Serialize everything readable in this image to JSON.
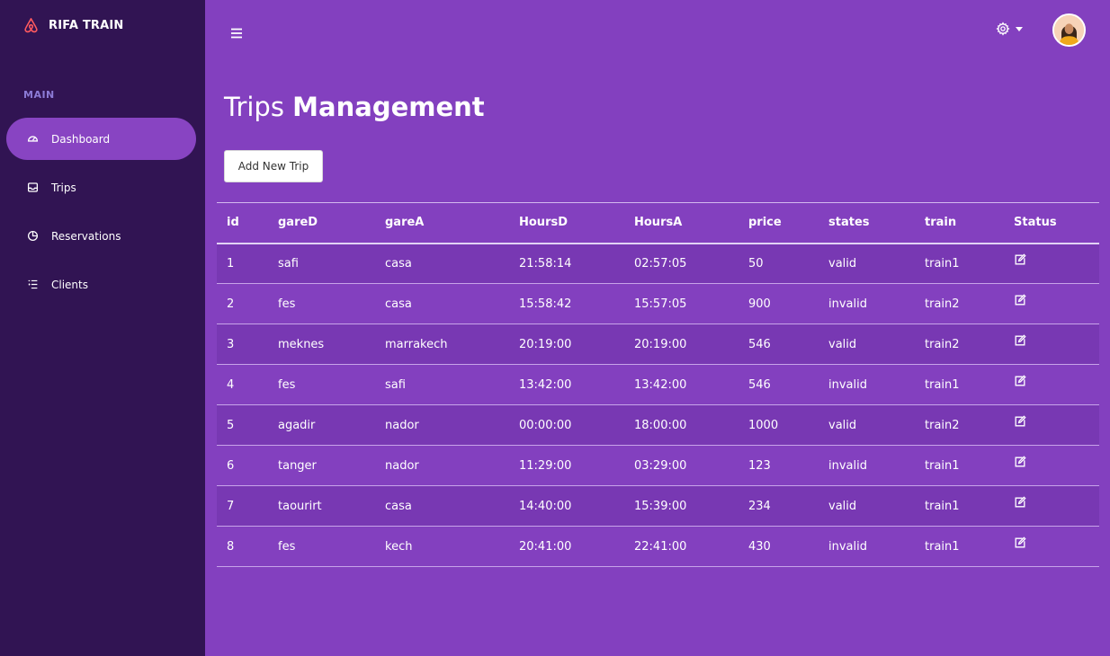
{
  "brand": {
    "name": "RIFA TRAIN",
    "icon": "airbnb-logo-icon"
  },
  "sidebar": {
    "section_title": "MAIN",
    "items": [
      {
        "label": "Dashboard",
        "icon": "dashboard-gauge-icon",
        "active": true
      },
      {
        "label": "Trips",
        "icon": "inbox-icon"
      },
      {
        "label": "Reservations",
        "icon": "pie-chart-icon"
      },
      {
        "label": "Clients",
        "icon": "list-icon"
      }
    ]
  },
  "header": {
    "menu_icon": "hamburger-icon",
    "settings_icon": "gear-icon"
  },
  "page": {
    "title_light": "Trips",
    "title_bold": "Management",
    "add_button": "Add New Trip"
  },
  "table": {
    "columns": [
      "id",
      "gareD",
      "gareA",
      "HoursD",
      "HoursA",
      "price",
      "states",
      "train",
      "Status"
    ],
    "rows": [
      [
        "1",
        "safi",
        "casa",
        "21:58:14",
        "02:57:05",
        "50",
        "valid",
        "train1"
      ],
      [
        "2",
        "fes",
        "casa",
        "15:58:42",
        "15:57:05",
        "900",
        "invalid",
        "train2"
      ],
      [
        "3",
        "meknes",
        "marrakech",
        "20:19:00",
        "20:19:00",
        "546",
        "valid",
        "train2"
      ],
      [
        "4",
        "fes",
        "safi",
        "13:42:00",
        "13:42:00",
        "546",
        "invalid",
        "train1"
      ],
      [
        "5",
        "agadir",
        "nador",
        "00:00:00",
        "18:00:00",
        "1000",
        "valid",
        "train2"
      ],
      [
        "6",
        "tanger",
        "nador",
        "11:29:00",
        "03:29:00",
        "123",
        "invalid",
        "train1"
      ],
      [
        "7",
        "taourirt",
        "casa",
        "14:40:00",
        "15:39:00",
        "234",
        "valid",
        "train1"
      ],
      [
        "8",
        "fes",
        "kech",
        "20:41:00",
        "22:41:00",
        "430",
        "invalid",
        "train1"
      ]
    ]
  },
  "colors": {
    "background": "#8340bf",
    "sidebar": "#311453",
    "active_item": "#8844c2",
    "section_title": "#8c7bd6"
  }
}
